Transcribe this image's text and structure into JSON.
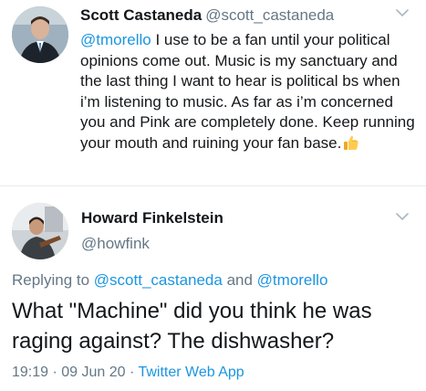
{
  "tweet1": {
    "display_name": "Scott Castaneda",
    "handle": "@scott_castaneda",
    "mention": "@tmorello",
    "text_after_mention": " I use to be a fan until your political opinions come out. Music is my sanctuary and the last thing I want to hear is political bs when i’m listening to music. As far as i’m concerned you and Pink are completely done. Keep running your mouth and ruining your fan base.",
    "emoji": "thumbs-up"
  },
  "tweet2": {
    "display_name": "Howard Finkelstein",
    "handle": "@howfink",
    "replying_prefix": "Replying to ",
    "replying_user1": "@scott_castaneda",
    "replying_and": " and ",
    "replying_user2": "@tmorello",
    "text": "What \"Machine\" did you think he was raging against? The dishwasher?",
    "time": "19:19 · 09 Jun 20 · ",
    "source": "Twitter Web App"
  },
  "colors": {
    "text": "#14171a",
    "secondary": "#657786",
    "link": "#1b95e0",
    "divider": "#e6ecf0"
  }
}
